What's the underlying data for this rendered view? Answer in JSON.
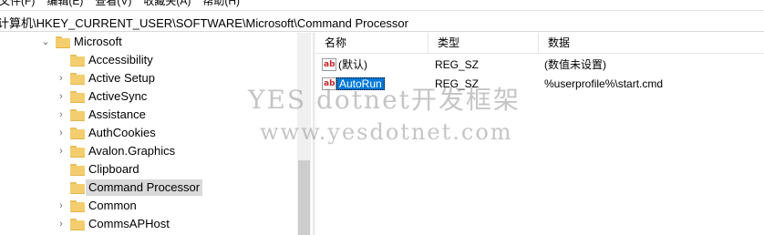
{
  "menubar": {
    "items": [
      "文件(F)",
      "编辑(E)",
      "查看(V)",
      "收藏夹(A)",
      "帮助(H)"
    ]
  },
  "address": {
    "path": "计算机\\HKEY_CURRENT_USER\\SOFTWARE\\Microsoft\\Command Processor"
  },
  "tree": {
    "parent": "Microsoft",
    "items": [
      {
        "label": "Accessibility",
        "expandable": false
      },
      {
        "label": "Active Setup",
        "expandable": true
      },
      {
        "label": "ActiveSync",
        "expandable": true
      },
      {
        "label": "Assistance",
        "expandable": true
      },
      {
        "label": "AuthCookies",
        "expandable": true
      },
      {
        "label": "Avalon.Graphics",
        "expandable": true
      },
      {
        "label": "Clipboard",
        "expandable": false
      },
      {
        "label": "Command Processor",
        "expandable": false,
        "selected": true
      },
      {
        "label": "Common",
        "expandable": true
      },
      {
        "label": "CommsAPHost",
        "expandable": true
      }
    ]
  },
  "list": {
    "headers": {
      "name": "名称",
      "type": "类型",
      "data": "数据"
    },
    "rows": [
      {
        "name": "(默认)",
        "type": "REG_SZ",
        "data": "(数值未设置)",
        "icon": "reg-string-icon",
        "selected": false
      },
      {
        "name": "AutoRun",
        "type": "REG_SZ",
        "data": "%userprofile%\\start.cmd",
        "icon": "reg-string-icon",
        "selected": true
      }
    ]
  },
  "watermark": {
    "line1": "YES dotnet开发框架",
    "line2": "www.yesdotnet.com"
  },
  "colors": {
    "selection": "#0078d7",
    "folder": "#f4ce6e",
    "tree_selection": "#d9d9d9"
  }
}
